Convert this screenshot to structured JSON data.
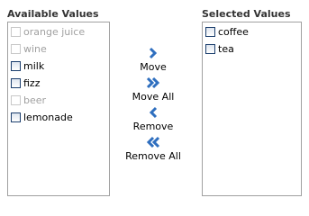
{
  "available": {
    "title": "Available Values",
    "items": [
      {
        "label": "orange juice",
        "enabled": false
      },
      {
        "label": "wine",
        "enabled": false
      },
      {
        "label": "milk",
        "enabled": true
      },
      {
        "label": "fizz",
        "enabled": true
      },
      {
        "label": "beer",
        "enabled": false
      },
      {
        "label": "lemonade",
        "enabled": true
      }
    ]
  },
  "selected": {
    "title": "Selected Values",
    "items": [
      {
        "label": "coffee",
        "enabled": true
      },
      {
        "label": "tea",
        "enabled": true
      }
    ]
  },
  "actions": {
    "move": "Move",
    "move_all": "Move All",
    "remove": "Remove",
    "remove_all": "Remove All"
  },
  "colors": {
    "arrow": "#2f6fbf",
    "border": "#a0a0a0",
    "disabled_text": "#a0a0a0"
  },
  "icons": {
    "move": "chevron-right-icon",
    "move_all": "double-chevron-right-icon",
    "remove": "chevron-left-icon",
    "remove_all": "double-chevron-left-icon"
  }
}
